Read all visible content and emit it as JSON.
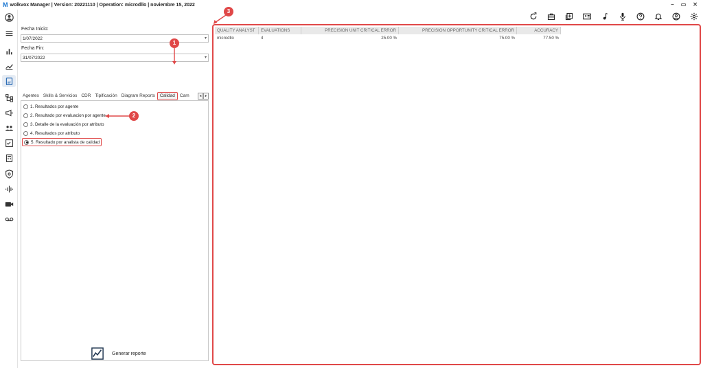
{
  "titlebar": {
    "logo": "M",
    "title": "wolkvox Manager  | Version: 20221110 |  Operation: microdllo | noviembre 15, 2022",
    "minimize": "–",
    "restore": "▭",
    "close": "✕"
  },
  "rail": {
    "items": [
      "user-icon",
      "menu-icon",
      "bar-chart-icon",
      "analytics-icon",
      "reports-icon",
      "hierarchy-icon",
      "campaign-icon",
      "users-group-icon",
      "checklist-icon",
      "calculator-icon",
      "shield-icon",
      "audio-wave-icon",
      "video-icon",
      "voicemail-icon"
    ],
    "active": "reports-icon"
  },
  "toolbar": {
    "icons": [
      "refresh-icon",
      "toolbox-icon",
      "add-layer-icon",
      "contact-card-icon",
      "music-note-icon",
      "microphone-icon",
      "help-icon",
      "bell-icon",
      "account-icon",
      "settings-icon"
    ]
  },
  "form": {
    "start_label": "Fecha Inicio:",
    "start_value": "1/07/2022",
    "end_label": "Fecha Fin:",
    "end_value": "31/07/2022",
    "tabs": [
      "Agentes",
      "Skills & Servicios",
      "CDR",
      "Tipificación",
      "Diagram Reports",
      "Calidad",
      "Cam"
    ],
    "selected_tab": "Calidad",
    "options": [
      {
        "label": "1. Resultados por agente",
        "checked": false
      },
      {
        "label": "2. Resultado por evaluacion por agente",
        "checked": false
      },
      {
        "label": "3. Detalle de la evaluación por atributo",
        "checked": false
      },
      {
        "label": "4. Resultados por atributo",
        "checked": false
      },
      {
        "label": "5. Resultado por analista de calidad",
        "checked": true
      }
    ],
    "generate_label": "Generar reporte"
  },
  "callouts": {
    "c1": "1",
    "c2": "2",
    "c3": "3"
  },
  "grid": {
    "columns": [
      "QUALITY ANALYST",
      "EVALUATIONS",
      "PRECISION UNIT CRITICAL ERROR",
      "PRECISION OPPORTUNITY CRITICAL ERROR",
      "ACCURACY"
    ],
    "rows": [
      [
        "microdllo",
        "4",
        "25.00 %",
        "75.00 %",
        "77.50 %"
      ]
    ]
  },
  "colors": {
    "accent": "#e04848",
    "header_bg": "#e9e9e9"
  }
}
